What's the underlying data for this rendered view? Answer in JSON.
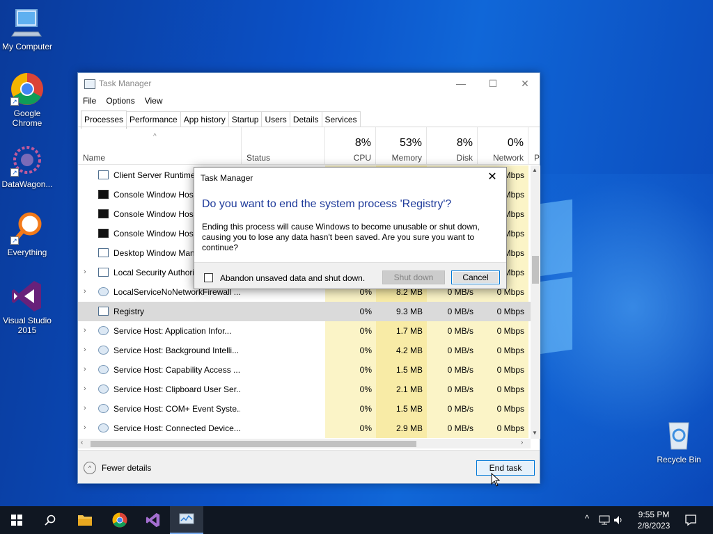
{
  "desktop": {
    "icons": [
      {
        "label": "My Computer",
        "icon": "monitor-icon"
      },
      {
        "label": "Google Chrome",
        "icon": "chrome-icon"
      },
      {
        "label": "DataWagon...",
        "icon": "datawagon-icon"
      },
      {
        "label": "Everything",
        "icon": "search-magnifier-icon"
      },
      {
        "label": "Visual Studio 2015",
        "icon": "visual-studio-icon"
      },
      {
        "label": "Recycle Bin",
        "icon": "recycle-bin-icon"
      }
    ]
  },
  "taskmanager": {
    "title": "Task Manager",
    "menu": [
      "File",
      "Options",
      "View"
    ],
    "tabs": [
      "Processes",
      "Performance",
      "App history",
      "Startup",
      "Users",
      "Details",
      "Services"
    ],
    "active_tab": "Processes",
    "columns": {
      "name": "Name",
      "status": "Status",
      "cpu": {
        "pct": "8%",
        "label": "CPU"
      },
      "memory": {
        "pct": "53%",
        "label": "Memory"
      },
      "disk": {
        "pct": "8%",
        "label": "Disk"
      },
      "network": {
        "pct": "0%",
        "label": "Network"
      },
      "power_partial": "P"
    },
    "rows": [
      {
        "name": "Client Server Runtime ...",
        "expand": "",
        "cpu": "",
        "mem": "",
        "disk": "",
        "net": "Mbps",
        "icon": "app"
      },
      {
        "name": "Console Window Host",
        "expand": "",
        "cpu": "",
        "mem": "",
        "disk": "",
        "net": "Mbps",
        "icon": "console"
      },
      {
        "name": "Console Window Host",
        "expand": "",
        "cpu": "",
        "mem": "",
        "disk": "",
        "net": "Mbps",
        "icon": "console"
      },
      {
        "name": "Console Window Host",
        "expand": "",
        "cpu": "",
        "mem": "",
        "disk": "",
        "net": "Mbps",
        "icon": "console"
      },
      {
        "name": "Desktop Window Manager",
        "expand": "",
        "cpu": "",
        "mem": "",
        "disk": "",
        "net": "Mbps",
        "icon": "app"
      },
      {
        "name": "Local Security Authority ...",
        "expand": "›",
        "cpu": "",
        "mem": "",
        "disk": "",
        "net": "Mbps",
        "icon": "app"
      },
      {
        "name": "LocalServiceNoNetworkFirewall ...",
        "expand": "›",
        "cpu": "0%",
        "mem": "8.2 MB",
        "disk": "0 MB/s",
        "net": "0 Mbps",
        "icon": "gear"
      },
      {
        "name": "Registry",
        "expand": "",
        "cpu": "0%",
        "mem": "9.3 MB",
        "disk": "0 MB/s",
        "net": "0 Mbps",
        "icon": "app",
        "selected": true
      },
      {
        "name": "Service Host: Application Infor...",
        "expand": "›",
        "cpu": "0%",
        "mem": "1.7 MB",
        "disk": "0 MB/s",
        "net": "0 Mbps",
        "icon": "gear"
      },
      {
        "name": "Service Host: Background Intelli...",
        "expand": "›",
        "cpu": "0%",
        "mem": "4.2 MB",
        "disk": "0 MB/s",
        "net": "0 Mbps",
        "icon": "gear"
      },
      {
        "name": "Service Host: Capability Access ...",
        "expand": "›",
        "cpu": "0%",
        "mem": "1.5 MB",
        "disk": "0 MB/s",
        "net": "0 Mbps",
        "icon": "gear"
      },
      {
        "name": "Service Host: Clipboard User Ser...",
        "expand": "›",
        "cpu": "0%",
        "mem": "2.1 MB",
        "disk": "0 MB/s",
        "net": "0 Mbps",
        "icon": "gear"
      },
      {
        "name": "Service Host: COM+ Event Syste...",
        "expand": "›",
        "cpu": "0%",
        "mem": "1.5 MB",
        "disk": "0 MB/s",
        "net": "0 Mbps",
        "icon": "gear"
      },
      {
        "name": "Service Host: Connected Device...",
        "expand": "›",
        "cpu": "0%",
        "mem": "2.9 MB",
        "disk": "0 MB/s",
        "net": "0 Mbps",
        "icon": "gear"
      }
    ],
    "footer": {
      "fewer_details": "Fewer details",
      "end_task": "End task"
    }
  },
  "dialog": {
    "title": "Task Manager",
    "heading": "Do you want to end the system process 'Registry'?",
    "message": "Ending this process will cause Windows to become unusable or shut down, causing you to lose any data hasn't been saved. Are you sure you want to continue?",
    "checkbox_label": "Abandon unsaved data and shut down.",
    "shutdown_label": "Shut down",
    "cancel_label": "Cancel"
  },
  "taskbar": {
    "time": "9:55 PM",
    "date": "2/8/2023"
  }
}
